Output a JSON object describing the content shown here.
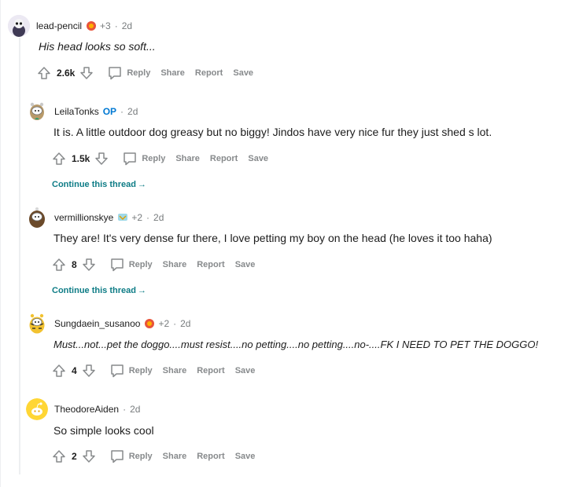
{
  "comments": [
    {
      "username": "lead-pencil",
      "op": "",
      "award_count": "+3",
      "time": "2d",
      "body": "His head looks so soft...",
      "score": "2.6k"
    },
    {
      "username": "LeilaTonks",
      "op": "OP",
      "award_count": "",
      "time": "2d",
      "body": "It is. A little outdoor dog greasy but no biggy! Jindos have very nice fur they just shed s lot.",
      "score": "1.5k"
    },
    {
      "username": "vermillionskye",
      "op": "",
      "award_count": "+2",
      "time": "2d",
      "body": "They are! It's very dense fur there, I love petting my boy on the head (he loves it too haha)",
      "score": "8"
    },
    {
      "username": "Sungdaein_susanoo",
      "op": "",
      "award_count": "+2",
      "time": "2d",
      "body": "Must...not...pet the doggo....must resist....no petting....no petting....no-....FK I NEED TO PET THE DOGGO!",
      "score": "4"
    },
    {
      "username": "TheodoreAiden",
      "op": "",
      "award_count": "",
      "time": "2d",
      "body": "So simple looks cool",
      "score": "2"
    }
  ],
  "actions": {
    "reply": "Reply",
    "share": "Share",
    "report": "Report",
    "save": "Save"
  },
  "separator": "·",
  "continue_thread": "Continue this thread",
  "colors": {
    "accent_teal": "#0e7c86",
    "op_blue": "#0079d3",
    "muted": "#878a8c",
    "thread_line": "#edeff1"
  },
  "icons": {
    "upvote": "upvote-arrow-icon",
    "downvote": "downvote-arrow-icon",
    "reply": "speech-bubble-icon",
    "award": "award-icon",
    "continue": "arrow-right-icon"
  }
}
